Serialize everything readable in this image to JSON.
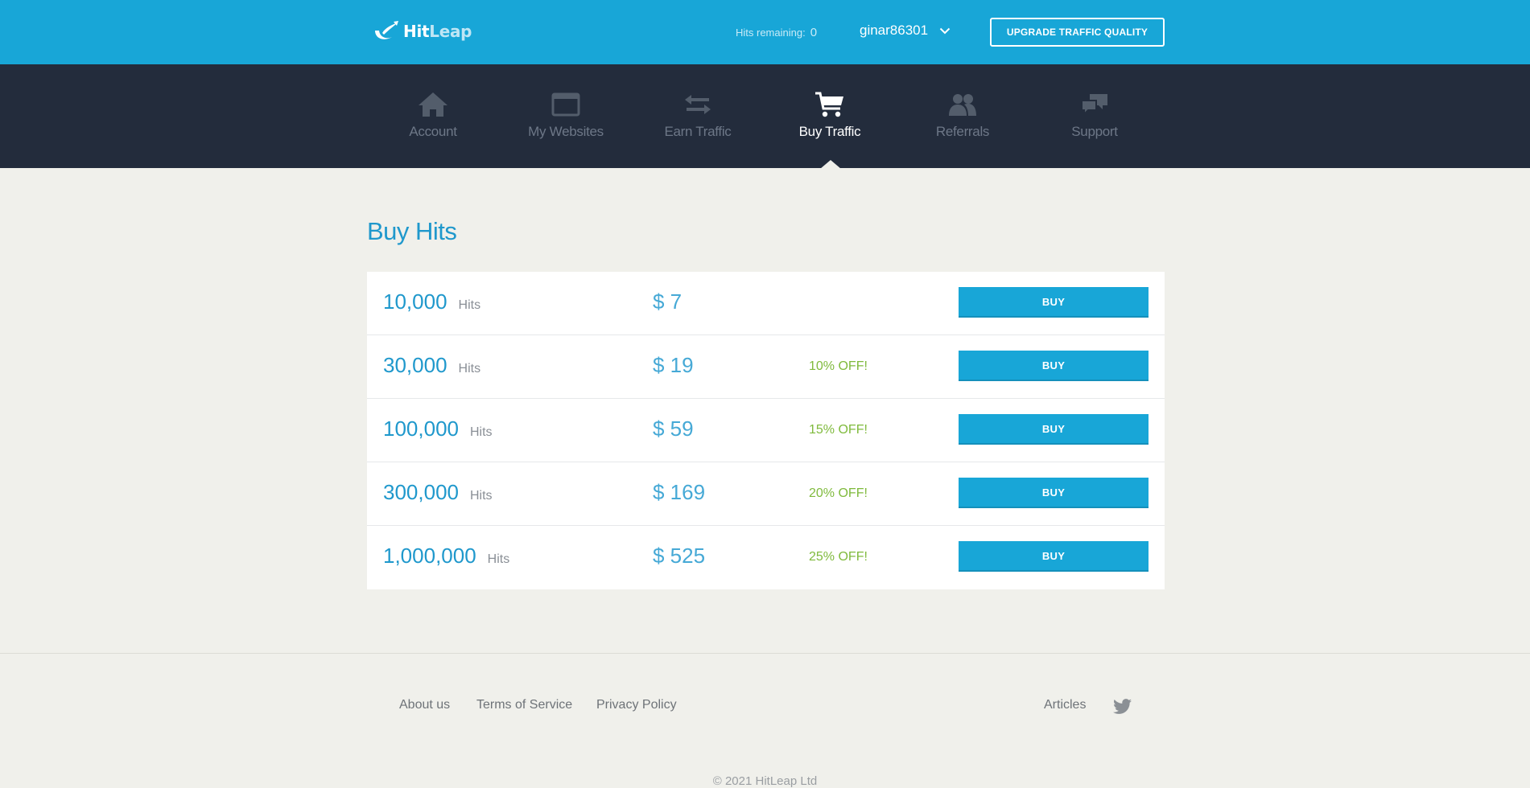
{
  "app": {
    "logo_part1": "Hit",
    "logo_part2": "Leap"
  },
  "header": {
    "hits_remaining_label": "Hits remaining:",
    "hits_remaining_value": "0",
    "username": "ginar86301",
    "upgrade_label": "UPGRADE TRAFFIC QUALITY"
  },
  "nav": {
    "items": [
      {
        "label": "Account",
        "icon": "home-icon"
      },
      {
        "label": "My Websites",
        "icon": "browser-window-icon"
      },
      {
        "label": "Earn Traffic",
        "icon": "exchange-arrows-icon"
      },
      {
        "label": "Buy Traffic",
        "icon": "shopping-cart-icon",
        "active": true
      },
      {
        "label": "Referrals",
        "icon": "users-icon"
      },
      {
        "label": "Support",
        "icon": "chat-bubbles-icon"
      }
    ]
  },
  "main": {
    "title": "Buy Hits",
    "packages": [
      {
        "hits": "10,000",
        "unit": "Hits",
        "price": "$ 7",
        "discount": "",
        "button": "BUY"
      },
      {
        "hits": "30,000",
        "unit": "Hits",
        "price": "$ 19",
        "discount": "10% OFF!",
        "button": "BUY"
      },
      {
        "hits": "100,000",
        "unit": "Hits",
        "price": "$ 59",
        "discount": "15% OFF!",
        "button": "BUY"
      },
      {
        "hits": "300,000",
        "unit": "Hits",
        "price": "$ 169",
        "discount": "20% OFF!",
        "button": "BUY"
      },
      {
        "hits": "1,000,000",
        "unit": "Hits",
        "price": "$ 525",
        "discount": "25% OFF!",
        "button": "BUY"
      }
    ]
  },
  "footer": {
    "about": "About us",
    "terms": "Terms of Service",
    "privacy": "Privacy Policy",
    "articles": "Articles",
    "twitter_icon": "twitter-icon",
    "copyright": "© 2021 HitLeap Ltd"
  },
  "colors": {
    "header_bg": "#18a6d7",
    "nav_bg": "#232c3c",
    "page_bg": "#f0f0eb",
    "accent": "#1f98cc",
    "discount": "#7fba3c"
  }
}
